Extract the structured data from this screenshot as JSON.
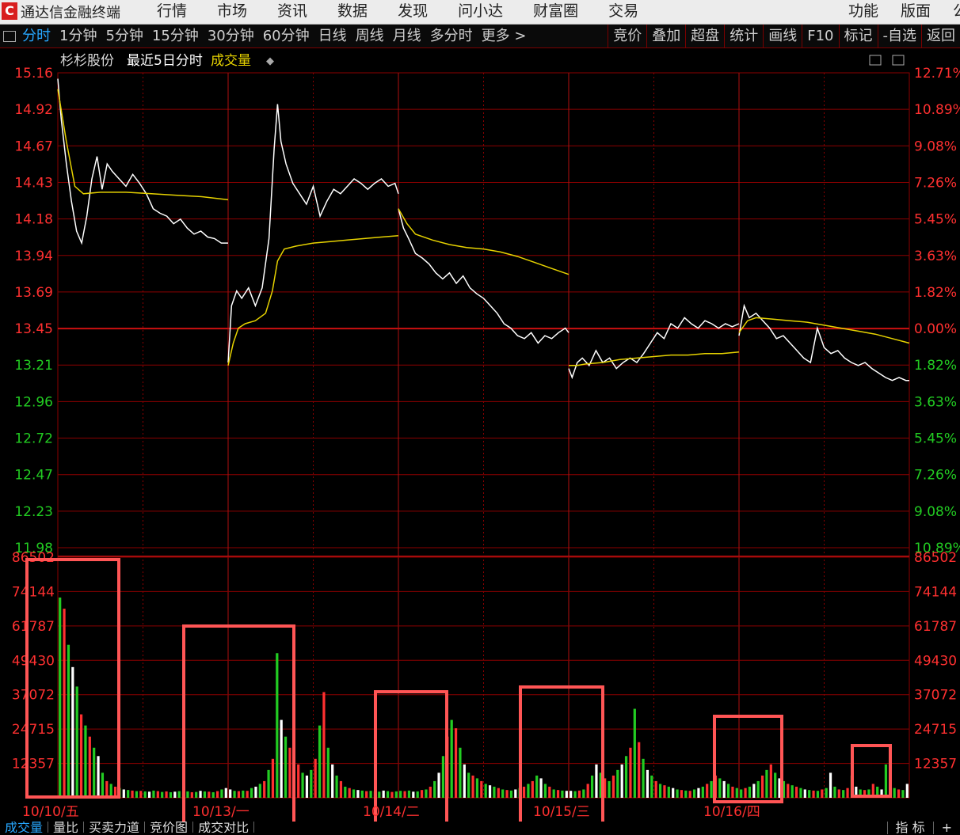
{
  "app": {
    "title": "通达信金融终端",
    "menu_left": [
      "行情",
      "市场",
      "资讯",
      "数据",
      "发现",
      "问小达",
      "财富圈",
      "交易"
    ],
    "menu_right": [
      "功能",
      "版面",
      "公"
    ]
  },
  "toolbar": {
    "periods": [
      "分时",
      "1分钟",
      "5分钟",
      "15分钟",
      "30分钟",
      "60分钟",
      "日线",
      "周线",
      "月线",
      "多分时",
      "更多 >"
    ],
    "active_period": "分时",
    "right_buttons": [
      "竞价",
      "叠加",
      "超盘",
      "统计",
      "画线",
      "F10",
      "标记",
      "-自选",
      "返回"
    ]
  },
  "chart_header": {
    "stock_name": "杉杉股份",
    "mode": "最近5日分时",
    "indicator": "成交量",
    "toggle_symbol": "◆"
  },
  "bottom_tabs": [
    "成交量",
    "量比",
    "买卖力道",
    "竞价图",
    "成交对比"
  ],
  "bottom_right_tabs": [
    "指 标",
    "+"
  ],
  "colors": {
    "background": "#000000",
    "grid": "#8b0000",
    "price_line": "#ffffff",
    "avg_line": "#e6d200",
    "up": "#ff3030",
    "down": "#22cc22",
    "neutral": "#ffffff",
    "axis_up_text": "#ff3030",
    "axis_down_text": "#22cc22",
    "highlight_box": "#ff5555"
  },
  "chart_data": [
    {
      "type": "line",
      "title": "",
      "days": [
        "10/10/五",
        "10/13/一",
        "10/14/二",
        "10/15/三",
        "10/16/四"
      ],
      "y_ticks_left": [
        "15.16",
        "14.92",
        "14.67",
        "14.43",
        "14.18",
        "13.94",
        "13.69",
        "13.45",
        "13.21",
        "12.96",
        "12.72",
        "12.47",
        "12.23",
        "11.98"
      ],
      "y_ticks_right": [
        "12.71%",
        "10.89%",
        "9.08%",
        "7.26%",
        "5.45%",
        "3.63%",
        "1.82%",
        "0.00%",
        "1.82%",
        "3.63%",
        "5.45%",
        "7.26%",
        "9.08%",
        "10.89%"
      ],
      "ylim": [
        11.98,
        15.16
      ],
      "reference_price": 13.45,
      "series": [
        {
          "points": [
            [
              0,
              15.12
            ],
            [
              0.02,
              14.85
            ],
            [
              0.05,
              14.55
            ],
            [
              0.08,
              14.3
            ],
            [
              0.11,
              14.1
            ],
            [
              0.14,
              14.02
            ],
            [
              0.17,
              14.2
            ],
            [
              0.2,
              14.45
            ],
            [
              0.23,
              14.6
            ],
            [
              0.26,
              14.38
            ],
            [
              0.29,
              14.55
            ],
            [
              0.32,
              14.5
            ],
            [
              0.36,
              14.45
            ],
            [
              0.4,
              14.4
            ],
            [
              0.44,
              14.48
            ],
            [
              0.48,
              14.42
            ],
            [
              0.52,
              14.35
            ],
            [
              0.56,
              14.25
            ],
            [
              0.6,
              14.22
            ],
            [
              0.64,
              14.2
            ],
            [
              0.68,
              14.15
            ],
            [
              0.72,
              14.18
            ],
            [
              0.76,
              14.12
            ],
            [
              0.8,
              14.08
            ],
            [
              0.84,
              14.1
            ],
            [
              0.88,
              14.06
            ],
            [
              0.92,
              14.05
            ],
            [
              0.96,
              14.02
            ],
            [
              1,
              14.02
            ],
            [
              1.0,
              13.22
            ],
            [
              1.02,
              13.6
            ],
            [
              1.05,
              13.7
            ],
            [
              1.08,
              13.65
            ],
            [
              1.12,
              13.72
            ],
            [
              1.16,
              13.6
            ],
            [
              1.2,
              13.72
            ],
            [
              1.24,
              14.05
            ],
            [
              1.27,
              14.65
            ],
            [
              1.29,
              14.95
            ],
            [
              1.31,
              14.7
            ],
            [
              1.34,
              14.55
            ],
            [
              1.38,
              14.42
            ],
            [
              1.42,
              14.35
            ],
            [
              1.46,
              14.28
            ],
            [
              1.5,
              14.4
            ],
            [
              1.54,
              14.2
            ],
            [
              1.58,
              14.3
            ],
            [
              1.62,
              14.38
            ],
            [
              1.66,
              14.35
            ],
            [
              1.7,
              14.4
            ],
            [
              1.74,
              14.45
            ],
            [
              1.78,
              14.42
            ],
            [
              1.82,
              14.38
            ],
            [
              1.86,
              14.42
            ],
            [
              1.9,
              14.45
            ],
            [
              1.94,
              14.4
            ],
            [
              1.98,
              14.42
            ],
            [
              2,
              14.35
            ],
            [
              2.0,
              14.25
            ],
            [
              2.03,
              14.12
            ],
            [
              2.06,
              14.05
            ],
            [
              2.1,
              13.95
            ],
            [
              2.14,
              13.92
            ],
            [
              2.18,
              13.88
            ],
            [
              2.22,
              13.82
            ],
            [
              2.26,
              13.78
            ],
            [
              2.3,
              13.82
            ],
            [
              2.34,
              13.75
            ],
            [
              2.38,
              13.8
            ],
            [
              2.42,
              13.72
            ],
            [
              2.46,
              13.68
            ],
            [
              2.5,
              13.65
            ],
            [
              2.54,
              13.6
            ],
            [
              2.58,
              13.55
            ],
            [
              2.62,
              13.48
            ],
            [
              2.66,
              13.45
            ],
            [
              2.7,
              13.4
            ],
            [
              2.74,
              13.38
            ],
            [
              2.78,
              13.42
            ],
            [
              2.82,
              13.35
            ],
            [
              2.86,
              13.4
            ],
            [
              2.9,
              13.38
            ],
            [
              2.94,
              13.42
            ],
            [
              2.98,
              13.45
            ],
            [
              3,
              13.42
            ],
            [
              3.0,
              13.18
            ],
            [
              3.02,
              13.12
            ],
            [
              3.05,
              13.22
            ],
            [
              3.08,
              13.25
            ],
            [
              3.12,
              13.2
            ],
            [
              3.16,
              13.3
            ],
            [
              3.2,
              13.22
            ],
            [
              3.24,
              13.25
            ],
            [
              3.28,
              13.18
            ],
            [
              3.32,
              13.22
            ],
            [
              3.36,
              13.25
            ],
            [
              3.4,
              13.22
            ],
            [
              3.44,
              13.28
            ],
            [
              3.48,
              13.35
            ],
            [
              3.52,
              13.42
            ],
            [
              3.56,
              13.38
            ],
            [
              3.6,
              13.48
            ],
            [
              3.64,
              13.45
            ],
            [
              3.68,
              13.52
            ],
            [
              3.72,
              13.48
            ],
            [
              3.76,
              13.45
            ],
            [
              3.8,
              13.5
            ],
            [
              3.84,
              13.48
            ],
            [
              3.88,
              13.45
            ],
            [
              3.92,
              13.48
            ],
            [
              3.96,
              13.46
            ],
            [
              4,
              13.48
            ],
            [
              4.0,
              13.4
            ],
            [
              4.03,
              13.6
            ],
            [
              4.06,
              13.52
            ],
            [
              4.1,
              13.55
            ],
            [
              4.14,
              13.5
            ],
            [
              4.18,
              13.45
            ],
            [
              4.22,
              13.38
            ],
            [
              4.26,
              13.4
            ],
            [
              4.3,
              13.35
            ],
            [
              4.34,
              13.3
            ],
            [
              4.38,
              13.25
            ],
            [
              4.42,
              13.22
            ],
            [
              4.46,
              13.45
            ],
            [
              4.5,
              13.32
            ],
            [
              4.54,
              13.28
            ],
            [
              4.58,
              13.3
            ],
            [
              4.62,
              13.25
            ],
            [
              4.66,
              13.22
            ],
            [
              4.7,
              13.2
            ],
            [
              4.74,
              13.22
            ],
            [
              4.78,
              13.18
            ],
            [
              4.82,
              13.15
            ],
            [
              4.86,
              13.12
            ],
            [
              4.9,
              13.1
            ],
            [
              4.94,
              13.12
            ],
            [
              4.98,
              13.1
            ],
            [
              5,
              13.1
            ]
          ]
        },
        {
          "points": [
            [
              0,
              15.05
            ],
            [
              0.05,
              14.7
            ],
            [
              0.1,
              14.4
            ],
            [
              0.15,
              14.35
            ],
            [
              0.25,
              14.36
            ],
            [
              0.4,
              14.36
            ],
            [
              0.55,
              14.35
            ],
            [
              0.7,
              14.34
            ],
            [
              0.85,
              14.33
            ],
            [
              1,
              14.31
            ],
            [
              1.0,
              13.2
            ],
            [
              1.03,
              13.35
            ],
            [
              1.06,
              13.45
            ],
            [
              1.1,
              13.48
            ],
            [
              1.16,
              13.5
            ],
            [
              1.22,
              13.55
            ],
            [
              1.26,
              13.7
            ],
            [
              1.29,
              13.9
            ],
            [
              1.33,
              13.98
            ],
            [
              1.4,
              14.0
            ],
            [
              1.5,
              14.02
            ],
            [
              1.6,
              14.03
            ],
            [
              1.7,
              14.04
            ],
            [
              1.8,
              14.05
            ],
            [
              1.9,
              14.06
            ],
            [
              2,
              14.07
            ],
            [
              2.0,
              14.25
            ],
            [
              2.05,
              14.15
            ],
            [
              2.1,
              14.08
            ],
            [
              2.2,
              14.04
            ],
            [
              2.3,
              14.01
            ],
            [
              2.4,
              13.99
            ],
            [
              2.5,
              13.98
            ],
            [
              2.6,
              13.96
            ],
            [
              2.7,
              13.93
            ],
            [
              2.8,
              13.89
            ],
            [
              2.9,
              13.85
            ],
            [
              3,
              13.81
            ],
            [
              3.0,
              13.2
            ],
            [
              3.05,
              13.2
            ],
            [
              3.1,
              13.21
            ],
            [
              3.2,
              13.22
            ],
            [
              3.3,
              13.24
            ],
            [
              3.4,
              13.25
            ],
            [
              3.5,
              13.26
            ],
            [
              3.6,
              13.27
            ],
            [
              3.7,
              13.27
            ],
            [
              3.8,
              13.28
            ],
            [
              3.9,
              13.28
            ],
            [
              4,
              13.29
            ],
            [
              4.0,
              13.42
            ],
            [
              4.05,
              13.5
            ],
            [
              4.1,
              13.52
            ],
            [
              4.2,
              13.51
            ],
            [
              4.3,
              13.5
            ],
            [
              4.4,
              13.49
            ],
            [
              4.5,
              13.47
            ],
            [
              4.6,
              13.45
            ],
            [
              4.7,
              13.43
            ],
            [
              4.8,
              13.41
            ],
            [
              4.9,
              13.38
            ],
            [
              5,
              13.35
            ]
          ]
        }
      ]
    },
    {
      "type": "bar",
      "title": "成交量",
      "y_ticks": [
        "86502",
        "74144",
        "61787",
        "49430",
        "37072",
        "24715",
        "12357"
      ],
      "ylim": [
        0,
        86502
      ],
      "bars_per_day": 40,
      "day_peaks": [
        [
          72000,
          68000,
          55000,
          47000,
          40000,
          30000,
          26000,
          22000,
          18000,
          15000,
          9000,
          6000,
          5000,
          4000,
          3500,
          3000,
          2800,
          2600,
          2400,
          2500,
          2300,
          2200,
          2600,
          2400,
          2100,
          2300,
          2000,
          2200,
          2400,
          2100,
          2300,
          2000,
          2100,
          2500,
          2300,
          2200,
          2000,
          2400,
          3000,
          3500
        ],
        [
          3000,
          2500,
          2400,
          2600,
          2500,
          3500,
          4000,
          5000,
          6000,
          10000,
          14000,
          52000,
          28000,
          22000,
          18000,
          15000,
          12000,
          9000,
          8000,
          10000,
          14000,
          26000,
          38000,
          18000,
          12000,
          8000,
          6000,
          4000,
          3500,
          3000,
          2800,
          2600,
          2400,
          2500,
          2300,
          2200,
          2600,
          2400,
          2100,
          2300
        ],
        [
          2500,
          2400,
          2600,
          2200,
          2300,
          2800,
          3000,
          4000,
          6000,
          9000,
          15000,
          22000,
          28000,
          25000,
          18000,
          12000,
          9000,
          8000,
          7000,
          6000,
          5000,
          4500,
          4000,
          3500,
          3000,
          2800,
          2600,
          3000,
          3500,
          4000,
          5000,
          6000,
          8000,
          7000,
          5000,
          4000,
          3000,
          2800,
          2600,
          2500
        ],
        [
          2500,
          2400,
          2600,
          3000,
          5000,
          8000,
          12000,
          9000,
          7000,
          6000,
          8000,
          10000,
          12000,
          15000,
          18000,
          32000,
          20000,
          14000,
          10000,
          8000,
          6000,
          5000,
          4500,
          4000,
          3500,
          3000,
          2800,
          2600,
          2500,
          3000,
          3500,
          4000,
          5000,
          6000,
          8000,
          7000,
          6000,
          5000,
          4000,
          3500
        ],
        [
          3000,
          3500,
          4000,
          5000,
          6000,
          8000,
          10000,
          12000,
          9000,
          7000,
          6000,
          5000,
          4500,
          4000,
          3500,
          3000,
          2800,
          2600,
          2500,
          3000,
          3500,
          9000,
          4000,
          3000,
          2800,
          3500,
          8000,
          4000,
          3000,
          2800,
          3000,
          5000,
          4000,
          3000,
          12000,
          4000,
          3500,
          3000,
          2800,
          5000
        ]
      ]
    }
  ]
}
